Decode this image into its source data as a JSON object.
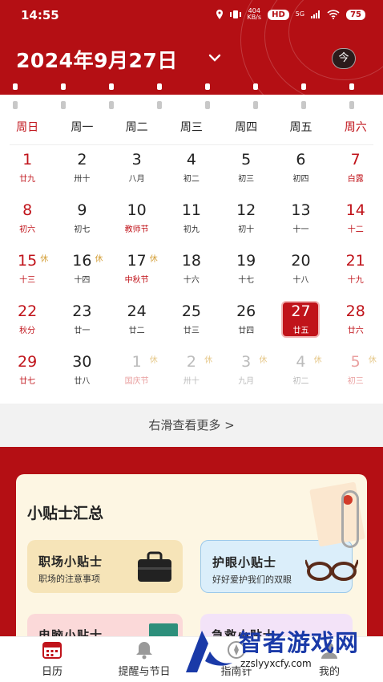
{
  "status": {
    "time": "14:55",
    "net_speed_value": "404",
    "net_speed_unit": "KB/s",
    "hd": "HD",
    "signal": "5G",
    "battery": "75"
  },
  "header": {
    "date_title": "2024年9月27日",
    "today_label": "今"
  },
  "weekdays": [
    "周日",
    "周一",
    "周二",
    "周三",
    "周四",
    "周五",
    "周六"
  ],
  "weeks": [
    [
      {
        "day": "1",
        "lunar": "廿九"
      },
      {
        "day": "2",
        "lunar": "卅十"
      },
      {
        "day": "3",
        "lunar": "八月"
      },
      {
        "day": "4",
        "lunar": "初二"
      },
      {
        "day": "5",
        "lunar": "初三"
      },
      {
        "day": "6",
        "lunar": "初四"
      },
      {
        "day": "7",
        "lunar": "白露"
      }
    ],
    [
      {
        "day": "8",
        "lunar": "初六"
      },
      {
        "day": "9",
        "lunar": "初七"
      },
      {
        "day": "10",
        "lunar": "教师节"
      },
      {
        "day": "11",
        "lunar": "初九"
      },
      {
        "day": "12",
        "lunar": "初十"
      },
      {
        "day": "13",
        "lunar": "十一"
      },
      {
        "day": "14",
        "lunar": "十二"
      }
    ],
    [
      {
        "day": "15",
        "lunar": "十三",
        "rest": "休"
      },
      {
        "day": "16",
        "lunar": "十四",
        "rest": "休"
      },
      {
        "day": "17",
        "lunar": "中秋节",
        "rest": "休"
      },
      {
        "day": "18",
        "lunar": "十六"
      },
      {
        "day": "19",
        "lunar": "十七"
      },
      {
        "day": "20",
        "lunar": "十八"
      },
      {
        "day": "21",
        "lunar": "十九"
      }
    ],
    [
      {
        "day": "22",
        "lunar": "秋分"
      },
      {
        "day": "23",
        "lunar": "廿一"
      },
      {
        "day": "24",
        "lunar": "廿二"
      },
      {
        "day": "25",
        "lunar": "廿三"
      },
      {
        "day": "26",
        "lunar": "廿四"
      },
      {
        "day": "27",
        "lunar": "廿五"
      },
      {
        "day": "28",
        "lunar": "廿六"
      }
    ],
    [
      {
        "day": "29",
        "lunar": "廿七"
      },
      {
        "day": "30",
        "lunar": "廿八"
      },
      {
        "day": "1",
        "lunar": "国庆节",
        "rest": "休"
      },
      {
        "day": "2",
        "lunar": "卅十",
        "rest": "休"
      },
      {
        "day": "3",
        "lunar": "九月",
        "rest": "休"
      },
      {
        "day": "4",
        "lunar": "初二",
        "rest": "休"
      },
      {
        "day": "5",
        "lunar": "初三",
        "rest": "休"
      }
    ]
  ],
  "more_label": "右滑查看更多 >",
  "tips": {
    "title": "小贴士汇总",
    "work": {
      "title": "职场小贴士",
      "subtitle": "职场的注意事项"
    },
    "eye": {
      "title": "护眼小贴士",
      "subtitle": "好好爱护我们的双眼"
    },
    "pc": {
      "title": "电脑小贴士"
    },
    "aid": {
      "title": "急救小贴士"
    }
  },
  "nav": [
    {
      "label": "日历"
    },
    {
      "label": "提醒与节日"
    },
    {
      "label": "指南针"
    },
    {
      "label": "我的"
    }
  ],
  "watermark": {
    "text": "智者游戏网",
    "url": "zzslyyxcfy.com"
  },
  "colors": {
    "brand_red": "#b40f14",
    "weekend_red": "#c0131a",
    "rest_gold": "#d4a03a"
  }
}
